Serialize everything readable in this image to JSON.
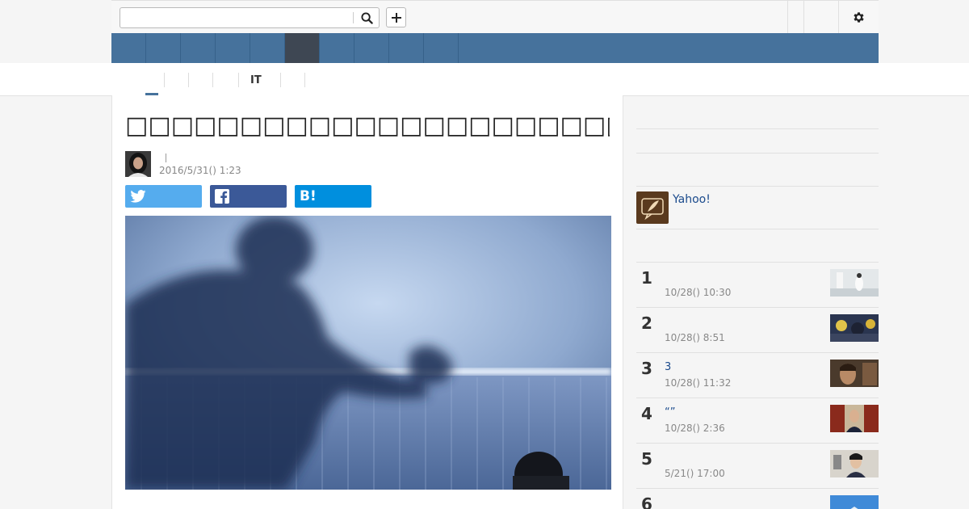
{
  "header": {
    "search": {
      "value": "",
      "placeholder": ""
    },
    "search_icon": "search-icon",
    "plus_icon": "plus-icon",
    "settings_icon": "gear-icon"
  },
  "nav": {
    "item_count": 10,
    "active_index": 5
  },
  "subnav": {
    "items": [
      "",
      "",
      "",
      "",
      "IT",
      "",
      ""
    ],
    "active_index": 0
  },
  "article": {
    "title": "□□□□□□□□□□□□□□□□□□□□□□□□□□□□□□□□□□□□□□□",
    "author_name": "",
    "date": "2016/5/31() 1:23",
    "share": {
      "twitter_label": "",
      "facebook_label": "",
      "hatena_label": "",
      "hatena_glyph": "B!"
    }
  },
  "sidebar": {
    "yahoo_label": "Yahoo!",
    "ranking": [
      {
        "rank": "1",
        "title": "",
        "time": "10/28() 10:30"
      },
      {
        "rank": "2",
        "title": "",
        "time": "10/28() 8:51"
      },
      {
        "rank": "3",
        "title": "3",
        "time": "10/28() 11:32"
      },
      {
        "rank": "4",
        "title": "“”",
        "time": "10/28() 2:36"
      },
      {
        "rank": "5",
        "title": "",
        "time": "5/21() 17:00"
      },
      {
        "rank": "6",
        "title": "",
        "time": ""
      }
    ]
  },
  "colors": {
    "nav_bg": "#46729c",
    "nav_active": "#3e4753",
    "twitter": "#55acee",
    "facebook": "#3b5998",
    "hatena": "#008fde",
    "link": "#1a4a8c"
  }
}
